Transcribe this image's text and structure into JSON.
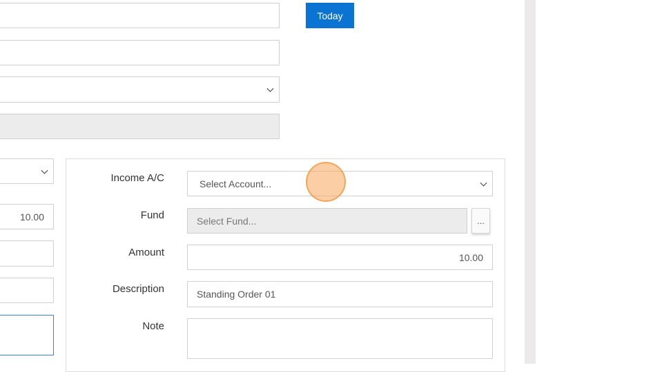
{
  "header_form": {
    "today_button": "Today"
  },
  "left_column": {
    "amount_value": "10.00"
  },
  "allocation_panel": {
    "income_ac_label": "Income A/C",
    "income_ac_placeholder": "Select Account...",
    "fund_label": "Fund",
    "fund_placeholder": "Select Fund...",
    "fund_lookup_button": "...",
    "amount_label": "Amount",
    "amount_value": "10.00",
    "description_label": "Description",
    "description_value": "Standing Order 01",
    "note_label": "Note",
    "note_value": ""
  },
  "colors": {
    "accent": "#0b73d1",
    "cursor_highlight": "#f7a65c",
    "disabled_field": "#ececec",
    "scrollbar_track": "#ebe9ea"
  }
}
